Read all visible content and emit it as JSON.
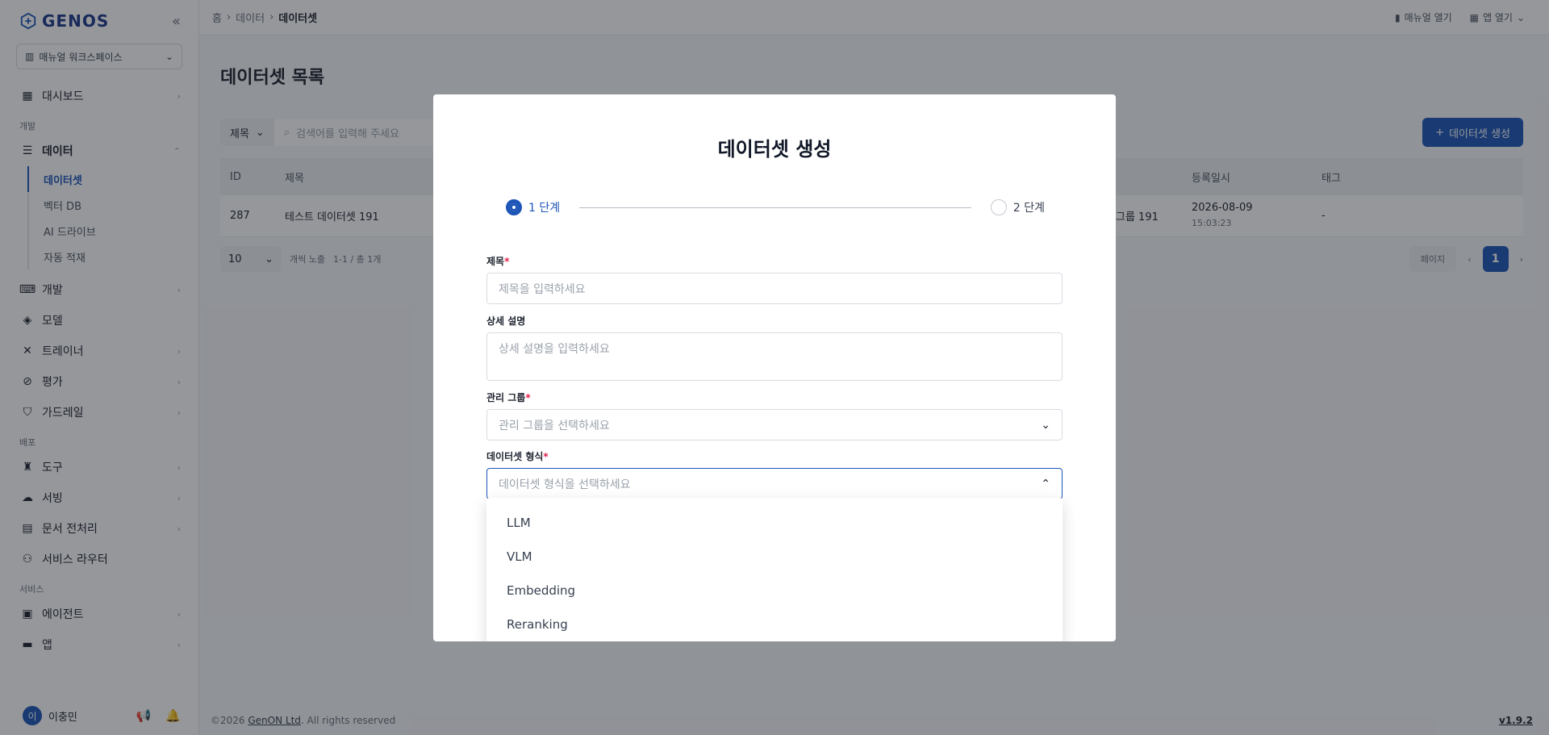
{
  "app": {
    "logo": "GENOS",
    "workspace": "매뉴얼 워크스페이스"
  },
  "sidebar": {
    "top_item": "대시보드",
    "section_dev": "개발",
    "data_item": "데이터",
    "data_sub": [
      "데이터셋",
      "벡터 DB",
      "AI 드라이브",
      "자동 적재"
    ],
    "dev_items": [
      "개발",
      "모델",
      "트레이너",
      "평가",
      "가드레일"
    ],
    "section_deploy": "배포",
    "deploy_items": [
      "도구",
      "서빙",
      "문서 전처리",
      "서비스 라우터"
    ],
    "section_service": "서비스",
    "service_items": [
      "에이전트",
      "앱"
    ],
    "user": {
      "initial": "이",
      "name": "이충민"
    }
  },
  "header": {
    "breadcrumb": [
      "홈",
      "데이터",
      "데이터셋"
    ],
    "manual": "매뉴얼 열기",
    "open_app": "앱 열기"
  },
  "main": {
    "title": "데이터셋 목록",
    "filter_select": "제목",
    "search_placeholder": "검색어를 입력해 주세요",
    "create_button": "데이터셋 생성",
    "columns": [
      "ID",
      "제목",
      "등록일시",
      "태그"
    ],
    "row": {
      "id": "287",
      "title": "테스트 데이터셋 191",
      "group": "그룹 191",
      "date": "2026-08-09",
      "time": "15:03:23",
      "tag": "-"
    },
    "page_size": "10",
    "page_size_label": "개씩 노출",
    "range": "1-1 / 총 1개",
    "page_label": "페이지",
    "current_page": "1"
  },
  "footer": {
    "copyright": "©2026",
    "company": "GenON Ltd",
    "rights": ". All rights reserved",
    "version": "v1.9.2"
  },
  "modal": {
    "title": "데이터셋 생성",
    "step1": "1 단계",
    "step2": "2 단계",
    "title_label": "제목",
    "title_placeholder": "제목을 입력하세요",
    "desc_label": "상세 설명",
    "desc_placeholder": "상세 설명을 입력하세요",
    "group_label": "관리 그룹",
    "group_placeholder": "관리 그룹을 선택하세요",
    "format_label": "데이터셋 형식",
    "format_placeholder": "데이터셋 형식을 선택하세요",
    "required_mark": "*",
    "options": [
      "LLM",
      "VLM",
      "Embedding",
      "Reranking"
    ]
  },
  "colors": {
    "accent": "#1e56b8",
    "required": "#e11d48"
  }
}
